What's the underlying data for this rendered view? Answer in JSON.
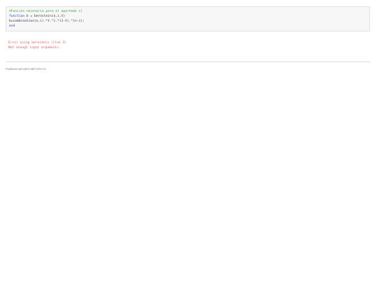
{
  "code": {
    "comment_line": "%Funcion necesaria para el apartado c)",
    "function_keyword": "function",
    "signature_rest": " b = bernstein(n,i,t)",
    "body_line": "b=combination(n,i).*t.^i.*(1-t).^(n-i);",
    "end_keyword": "end"
  },
  "error": {
    "line1": "Error using bernstein (line 3)",
    "line2": "Not enough input arguments."
  },
  "footer": {
    "text": "Published with MATLAB® R2017a"
  }
}
